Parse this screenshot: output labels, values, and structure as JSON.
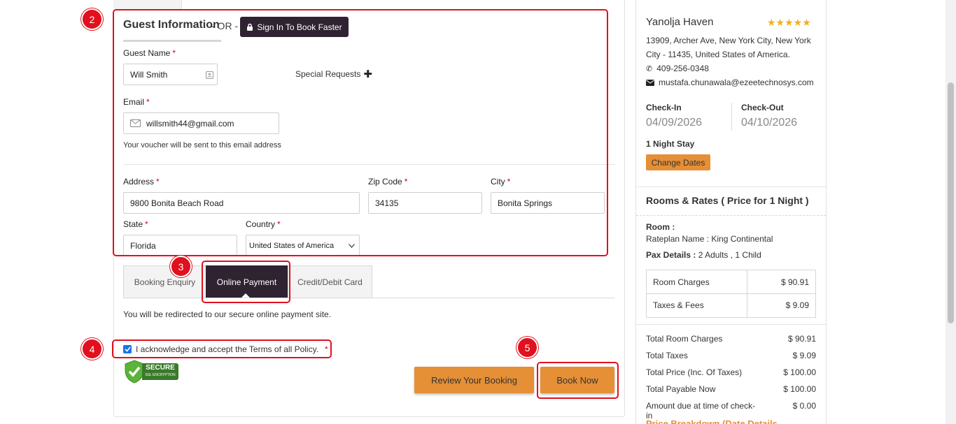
{
  "guest": {
    "title": "Guest Information",
    "or": "- OR -",
    "signin_label": "Sign In To Book Faster",
    "name_label": "Guest Name",
    "name_value": "Will Smith",
    "special_requests": "Special Requests",
    "email_label": "Email",
    "email_value": "willsmith44@gmail.com",
    "email_note": "Your voucher will be sent to this email address",
    "address_label": "Address",
    "address_value": "9800 Bonita Beach Road",
    "zip_label": "Zip Code",
    "zip_value": "34135",
    "city_label": "City",
    "city_value": "Bonita Springs",
    "state_label": "State",
    "state_value": "Florida",
    "country_label": "Country",
    "country_value": "United States of America",
    "required_mark": "*"
  },
  "payment": {
    "tabs": [
      "Booking Enquiry",
      "Online Payment",
      "Credit/Debit Card"
    ],
    "active_tab": "Online Payment",
    "redirect_note": "You will be redirected to our secure online payment site.",
    "terms_label": "I acknowledge and accept the Terms of all Policy.",
    "terms_checked": true,
    "secure_badge_line1": "SECURE",
    "secure_badge_line2": "SSL ENCRYPTION",
    "review_button": "Review Your Booking",
    "book_button": "Book Now"
  },
  "annotations": [
    "2",
    "3",
    "4",
    "5"
  ],
  "hotel": {
    "name": "Yanolja Haven",
    "stars": "★★★★★",
    "address_line1": "13909, Archer Ave, New York City, New York",
    "address_line2": "City - 11435, United States of America.",
    "phone": "409-256-0348",
    "email": "mustafa.chunawala@ezeetechnosys.com",
    "checkin_label": "Check-In",
    "checkin_date": "04/09/2026",
    "checkout_label": "Check-Out",
    "checkout_date": "04/10/2026",
    "stay": "1 Night Stay",
    "change_dates": "Change Dates"
  },
  "rates": {
    "title": "Rooms & Rates ( Price for 1 Night )",
    "room_label": "Room :",
    "rateplan": "Rateplan Name : King Continental",
    "pax_label": "Pax Details :",
    "pax_value": "2 Adults , 1 Child",
    "rows": [
      {
        "label": "Room Charges",
        "value": "$ 90.91"
      },
      {
        "label": "Taxes & Fees",
        "value": "$ 9.09"
      }
    ],
    "totals": [
      {
        "label": "Total Room Charges",
        "value": "$ 90.91"
      },
      {
        "label": "Total Taxes",
        "value": "$ 9.09"
      },
      {
        "label": "Total Price (Inc. Of Taxes)",
        "value": "$ 100.00"
      },
      {
        "label": "Total Payable Now",
        "value": "$ 100.00"
      },
      {
        "label": "Amount due at time of check-in",
        "value": "$ 0.00"
      }
    ],
    "breakdown_link": "Price Breakdown (Date Details"
  },
  "colors": {
    "accent_dark": "#2f2231",
    "accent_orange": "#e58f36",
    "annotation_red": "#e0101e",
    "star_gold": "#f2b01e"
  }
}
